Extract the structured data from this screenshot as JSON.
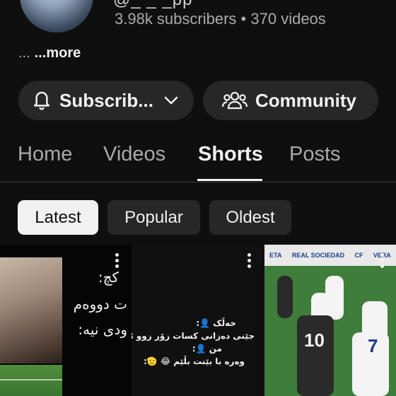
{
  "channel": {
    "handle_partial": "@_   _  _pp",
    "subscribers": "3.98k subscribers",
    "separator": "•",
    "videos": "370 videos",
    "desc_dots": "...",
    "more": "...more"
  },
  "actions": {
    "subscribe_label": "Subscrib...",
    "community_label": "Community"
  },
  "tabs": [
    {
      "label": "Home"
    },
    {
      "label": "Videos"
    },
    {
      "label": "Shorts",
      "active": true
    },
    {
      "label": "Posts"
    }
  ],
  "filters": [
    {
      "label": "Latest",
      "active": true
    },
    {
      "label": "Popular"
    },
    {
      "label": "Oldest"
    }
  ],
  "shorts": [
    {
      "caption_lines": [
        "کچ:",
        "ت دووەم",
        "ودی نیە:"
      ]
    },
    {
      "caption_lines": [
        "خەڵک 👤:",
        "جێنی دەزانی کسات زۆر زوو ئەروا 😢 ؟",
        "من 👤:",
        "وەرە با بێنت بڵێم 😂 🫡:"
      ]
    },
    {
      "caption_lines": [
        "10",
        "7"
      ],
      "board_text": [
        "ETA",
        "REAL SOCIEDAD",
        "CF",
        "VERA"
      ]
    }
  ],
  "colors": {
    "background": "#0f0f0f",
    "pill": "#272727",
    "text": "#f1f1f1",
    "muted": "#aaaaaa"
  }
}
